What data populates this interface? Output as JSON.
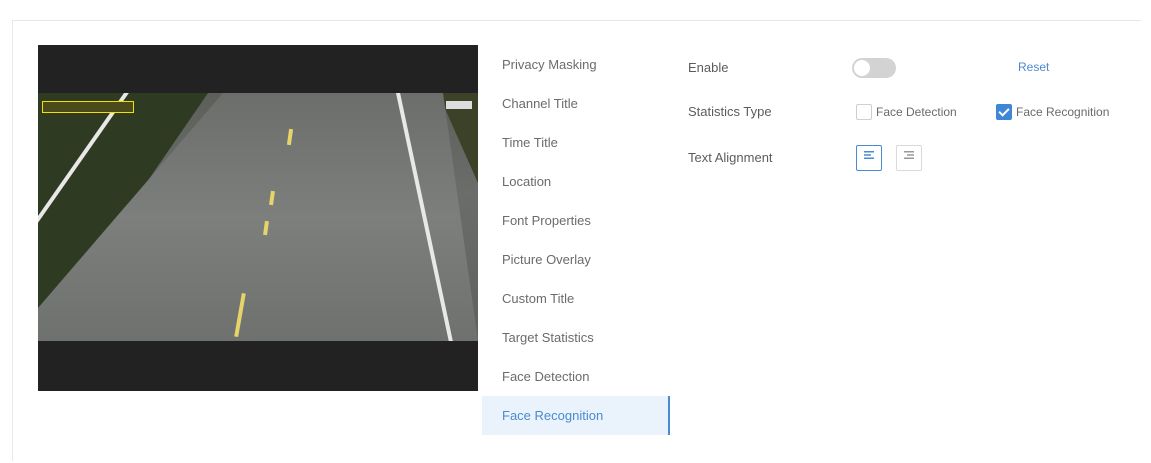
{
  "menu": {
    "items": [
      {
        "label": "Privacy Masking"
      },
      {
        "label": "Channel Title"
      },
      {
        "label": "Time Title"
      },
      {
        "label": "Location"
      },
      {
        "label": "Font Properties"
      },
      {
        "label": "Picture Overlay"
      },
      {
        "label": "Custom Title"
      },
      {
        "label": "Target Statistics"
      },
      {
        "label": "Face Detection"
      },
      {
        "label": "Face Recognition"
      }
    ],
    "active_index": 9
  },
  "settings": {
    "enable_label": "Enable",
    "enable_on": false,
    "reset_label": "Reset",
    "statistics_type_label": "Statistics Type",
    "face_detection_label": "Face Detection",
    "face_detection_checked": false,
    "face_recognition_label": "Face Recognition",
    "face_recognition_checked": true,
    "text_alignment_label": "Text Alignment",
    "left_align_icon": "align-left-icon",
    "right_align_icon": "align-right-icon"
  },
  "colors": {
    "accent": "#4a8ad0",
    "active_menu_bg": "#eaf3fb",
    "osd_yellow": "#f1e000"
  }
}
